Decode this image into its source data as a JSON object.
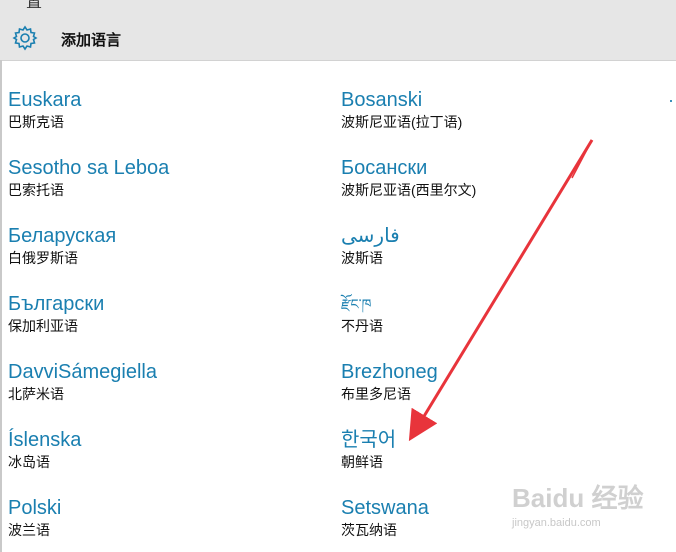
{
  "header": {
    "back_fragment": "置",
    "title": "添加语言",
    "icon": "gear-icon"
  },
  "languages_col1": [
    {
      "name": "Euskara",
      "sub": "巴斯克语"
    },
    {
      "name": "Sesotho sa Leboa",
      "sub": "巴索托语"
    },
    {
      "name": "Беларуская",
      "sub": "白俄罗斯语"
    },
    {
      "name": "Български",
      "sub": "保加利亚语"
    },
    {
      "name": "DavviSámegiella",
      "sub": "北萨米语"
    },
    {
      "name": "Íslenska",
      "sub": "冰岛语"
    },
    {
      "name": "Polski",
      "sub": "波兰语"
    }
  ],
  "languages_col2": [
    {
      "name": "Bosanski",
      "sub": "波斯尼亚语(拉丁语)"
    },
    {
      "name": "Босански",
      "sub": "波斯尼亚语(西里尔文)"
    },
    {
      "name": "فارسی",
      "sub": "波斯语"
    },
    {
      "name": "རྫོང་ཁ",
      "sub": "不丹语"
    },
    {
      "name": "Brezhoneg",
      "sub": "布里多尼语"
    },
    {
      "name": "한국어",
      "sub": "朝鲜语"
    },
    {
      "name": "Setswana",
      "sub": "茨瓦纳语"
    }
  ],
  "watermark": {
    "brand": "Baidu 经验",
    "site": "jingyan.baidu.com"
  },
  "colors": {
    "accent": "#1a7fb0",
    "arrow": "#e8343b",
    "header_bg": "#e6e6e6"
  }
}
